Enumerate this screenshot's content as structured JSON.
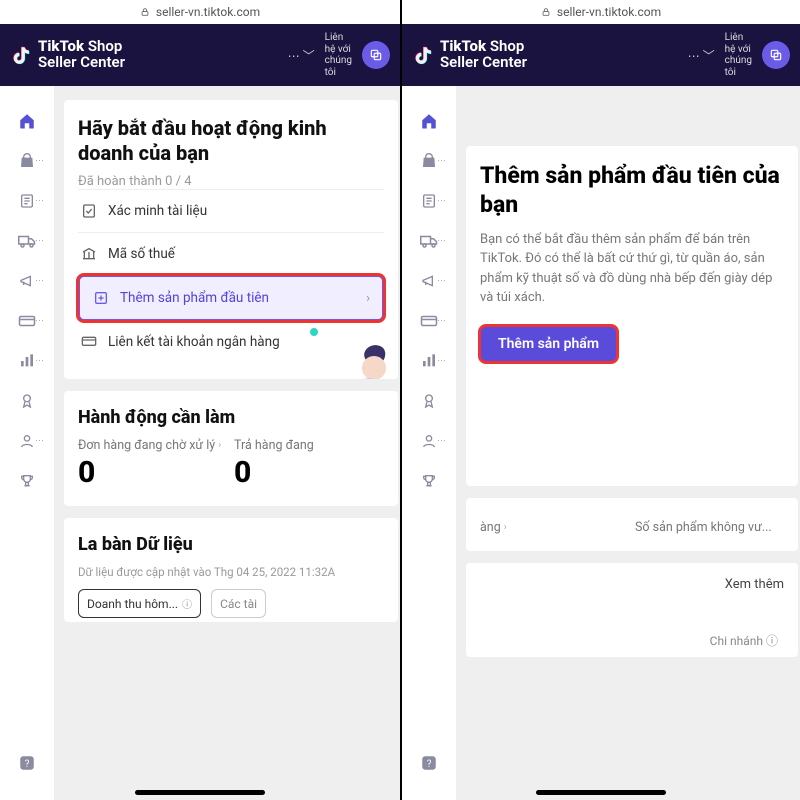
{
  "url": "seller-vn.tiktok.com",
  "brand": {
    "line1a": "TikTok",
    "line1b": " Shop",
    "line2": "Seller Center"
  },
  "header": {
    "contact": "Liên\nhệ với\nchúng\ntôi"
  },
  "left": {
    "start": {
      "title": "Hãy bắt đầu hoạt động kinh doanh của bạn",
      "progress": "Đã hoàn thành 0 / 4",
      "tasks": {
        "verify": "Xác minh tài liệu",
        "tax": "Mã số thuế",
        "first_product": "Thêm sản phẩm đầu tiên",
        "bank": "Liên kết tài khoản ngân hàng"
      }
    },
    "todo": {
      "title": "Hành động cần làm",
      "pending_label": "Đơn hàng đang chờ xử lý",
      "pending_value": "0",
      "returns_label": "Trả hàng đang",
      "returns_value": "0"
    },
    "compass": {
      "title": "La bàn Dữ liệu",
      "updated": "Dữ liệu được cập nhật vào Thg 04 25, 2022 11:32A",
      "tab": "Doanh thu hôm...",
      "tab2": "Các tài"
    }
  },
  "right": {
    "first": {
      "title": "Thêm sản phẩm đầu tiên của bạn",
      "desc": "Bạn có thể bắt đầu thêm sản phẩm để bán trên TikTok. Đó có thể là bất cứ thứ gì, từ quần áo, sản phẩm kỹ thuật số và đồ dùng nhà bếp đến giày dép và túi xách.",
      "button": "Thêm sản phẩm"
    },
    "stats": {
      "orders_label": "àng",
      "products_label": "Số sản phẩm không vư..."
    },
    "view_more": "Xem thêm",
    "branch": "Chi nhánh"
  }
}
